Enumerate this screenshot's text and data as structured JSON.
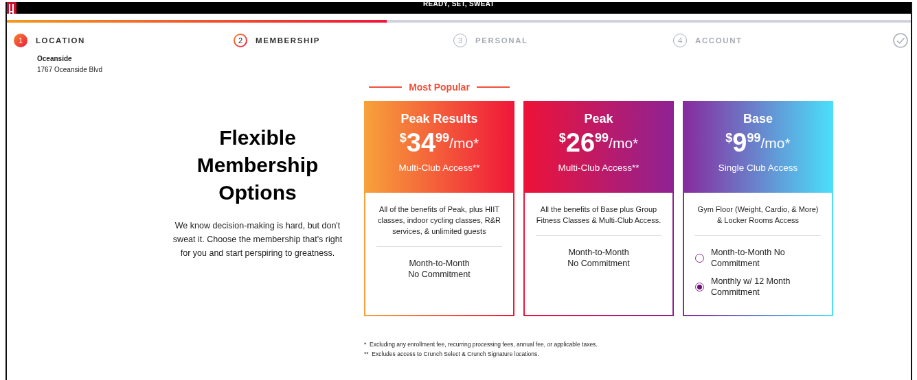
{
  "header": {
    "tagline": "READY, SET, SWEAT",
    "progress": {
      "level": 0.42
    }
  },
  "steps": [
    {
      "kind": "numbered",
      "number": "1",
      "label": "LOCATION",
      "done": true,
      "selected": false,
      "details": [
        "Oceanside",
        "1767 Oceanside Blvd"
      ]
    },
    {
      "kind": "numbered",
      "number": "2",
      "label": "MEMBERSHIP",
      "done": false,
      "selected": true
    },
    {
      "kind": "numbered",
      "number": "3",
      "label": "PERSONAL",
      "done": false,
      "selected": false
    },
    {
      "kind": "numbered",
      "number": "4",
      "label": "ACCOUNT",
      "done": false,
      "selected": false
    },
    {
      "kind": "finish",
      "done": false,
      "selected": false
    }
  ],
  "intro": {
    "title": "Flexible Membership Options",
    "text": "We know decision-making is hard, but don't sweat it. Choose the membership that's right for you and start perspiring to greatness."
  },
  "badge": "Most Popular",
  "plans": [
    {
      "color": "#f7a23a",
      "name": "Peak Results",
      "currency": "$",
      "whole": "34",
      "cents": "99",
      "unit": "/mo*",
      "access": "Multi-Club Access**",
      "description": "All of the benefits of Peak, plus HIIT classes, indoor cycling classes, R&R services, & unlimited guests",
      "terms": "Month-to-Month\nNo Commitment"
    },
    {
      "color": "#ee1238",
      "name": "Peak",
      "currency": "$",
      "whole": "26",
      "cents": "99",
      "unit": "/mo*",
      "access": "Multi-Club Access**",
      "description": "All the benefits of Base plus Group Fitness Classes & Multi-Club Access.",
      "terms": "Month-to-Month\nNo Commitment"
    },
    {
      "color": "#872a9e",
      "name": "Base",
      "currency": "$",
      "whole": "9",
      "cents": "99",
      "unit": "/mo*",
      "access": "Single Club Access",
      "description": "Gym Floor (Weight, Cardio, & More) & Locker Rooms Access",
      "options": [
        {
          "label": "Month-to-Month No Commitment",
          "selected": false
        },
        {
          "label": "Monthly w/ 12 Month Commitment",
          "selected": true
        }
      ]
    }
  ],
  "footnotes": [
    {
      "mark": "*",
      "text": "Excluding any enrollment fee, recurring processing fees, annual fee, or applicable taxes."
    },
    {
      "mark": "**",
      "text": "Excludes access to Crunch Select & Crunch Signature locations."
    }
  ]
}
